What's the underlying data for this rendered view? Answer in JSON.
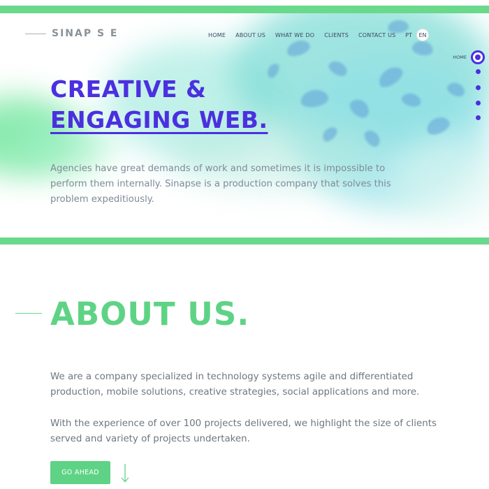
{
  "brand": {
    "logo_text": "SINAP S E"
  },
  "nav": {
    "items": [
      "HOME",
      "ABOUT US",
      "WHAT WE DO",
      "CLIENTS",
      "CONTACT US"
    ]
  },
  "language": {
    "options": [
      "PT",
      "EN"
    ],
    "selected": "EN"
  },
  "side_nav": {
    "active_label": "HOME"
  },
  "hero": {
    "title_line1": "CREATIVE &",
    "title_line2": "ENGAGING WEB.",
    "description": "Agencies have great demands of work and sometimes it is impossible to perform them internally. Sinapse is a production company that solves this problem expeditiously."
  },
  "about": {
    "title": "ABOUT US.",
    "paragraph1": "We are a company specialized in technology systems agile and differentiated production, mobile solutions, creative strategies, social applications and more.",
    "paragraph2": "With the experience of over 100 projects delivered, we highlight the size of clients served and variety of projects undertaken.",
    "button_label": "GO AHEAD"
  },
  "colors": {
    "accent_purple": "#4b2fe0",
    "accent_green": "#5fd385",
    "stripe_green": "#69d98b",
    "text_gray": "#7f8b97"
  },
  "icons": [
    "down-arrow-icon"
  ]
}
